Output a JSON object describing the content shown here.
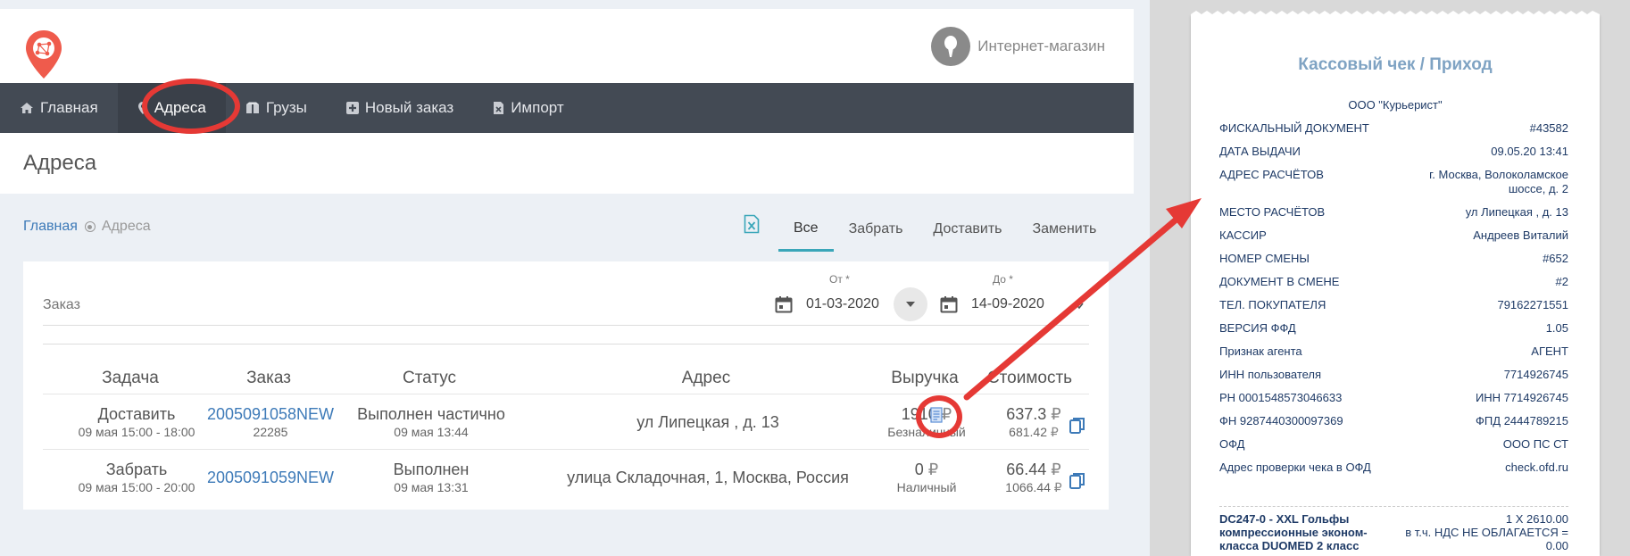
{
  "header": {
    "user_name": "Интернет-магазин"
  },
  "nav": {
    "items": [
      {
        "label": "Главная",
        "icon": "home-icon"
      },
      {
        "label": "Адреса",
        "icon": "map-pin-icon"
      },
      {
        "label": "Грузы",
        "icon": "box-icon"
      },
      {
        "label": "Новый заказ",
        "icon": "plus-square-icon"
      },
      {
        "label": "Импорт",
        "icon": "excel-file-icon"
      }
    ]
  },
  "page": {
    "title": "Адреса"
  },
  "breadcrumb": {
    "home": "Главная",
    "current": "Адреса"
  },
  "tabs": [
    "Все",
    "Забрать",
    "Доставить",
    "Заменить"
  ],
  "filter": {
    "order_placeholder": "Заказ",
    "from_label": "От *",
    "from_value": "01-03-2020",
    "to_label": "До *",
    "to_value": "14-09-2020"
  },
  "table": {
    "headers": [
      "Задача",
      "Заказ",
      "Статус",
      "Адрес",
      "Выручка",
      "Стоимость"
    ],
    "rows": [
      {
        "task": "Доставить",
        "task_time": "09 мая 15:00 - 18:00",
        "order": "2005091058NEW",
        "order_sub": "22285",
        "status": "Выполнен частично",
        "status_time": "09 мая 13:44",
        "address": "ул Липецкая , д. 13",
        "revenue": "1910",
        "revenue_type": "Безналичный",
        "cost": "637.3",
        "cost_sub": "681.42"
      },
      {
        "task": "Забрать",
        "task_time": "09 мая 15:00 - 20:00",
        "order": "2005091059NEW",
        "order_sub": "",
        "status": "Выполнен",
        "status_time": "09 мая 13:31",
        "address": "улица Складочная, 1, Москва, Россия",
        "revenue": "0",
        "revenue_type": "Наличный",
        "cost": "66.44",
        "cost_sub": "1066.44"
      }
    ],
    "currency": "₽"
  },
  "receipt": {
    "title": "Кассовый чек / Приход",
    "org": "ООО \"Курьерист\"",
    "rows": [
      {
        "k": "ФИСКАЛЬНЫЙ ДОКУМЕНТ",
        "v": "#43582"
      },
      {
        "k": "ДАТА ВЫДАЧИ",
        "v": "09.05.20 13:41"
      },
      {
        "k": "АДРЕС РАСЧЁТОВ",
        "v": "г. Москва, Волоколамское шоссе, д. 2"
      },
      {
        "k": "МЕСТО РАСЧЁТОВ",
        "v": "ул Липецкая , д. 13"
      },
      {
        "k": "КАССИР",
        "v": "Андреев Виталий"
      },
      {
        "k": "НОМЕР СМЕНЫ",
        "v": "#652"
      },
      {
        "k": "ДОКУМЕНТ В СМЕНЕ",
        "v": "#2"
      },
      {
        "k": "ТЕЛ. ПОКУПАТЕЛЯ",
        "v": "79162271551"
      },
      {
        "k": "ВЕРСИЯ ФФД",
        "v": "1.05"
      },
      {
        "k": "Признак агента",
        "v": "АГЕНТ"
      },
      {
        "k": "ИНН пользователя",
        "v": "7714926745"
      },
      {
        "k": "РН 0001548573046633",
        "v": "ИНН 7714926745"
      },
      {
        "k": "ФН 9287440300097369",
        "v": "ФПД 2444789215"
      },
      {
        "k": "ОФД",
        "v": "ООО ПС СТ"
      },
      {
        "k": "Адрес проверки чека в ОФД",
        "v": "check.ofd.ru"
      }
    ],
    "item": {
      "name": "DC247-0 - XXL Гольфы компрессионные эконом-класса DUOMED 2 класс",
      "qty": "1 X 2610.00",
      "vat": "в т.ч. НДС НЕ ОБЛАГАЕТСЯ = 0.00"
    }
  },
  "colors": {
    "accent": "#3aa6b9",
    "link": "#3d7ab8",
    "nav_bg": "#434a54",
    "highlight": "#e53935",
    "logo": "#ef5b4c",
    "receipt_text": "#1e3a66"
  }
}
